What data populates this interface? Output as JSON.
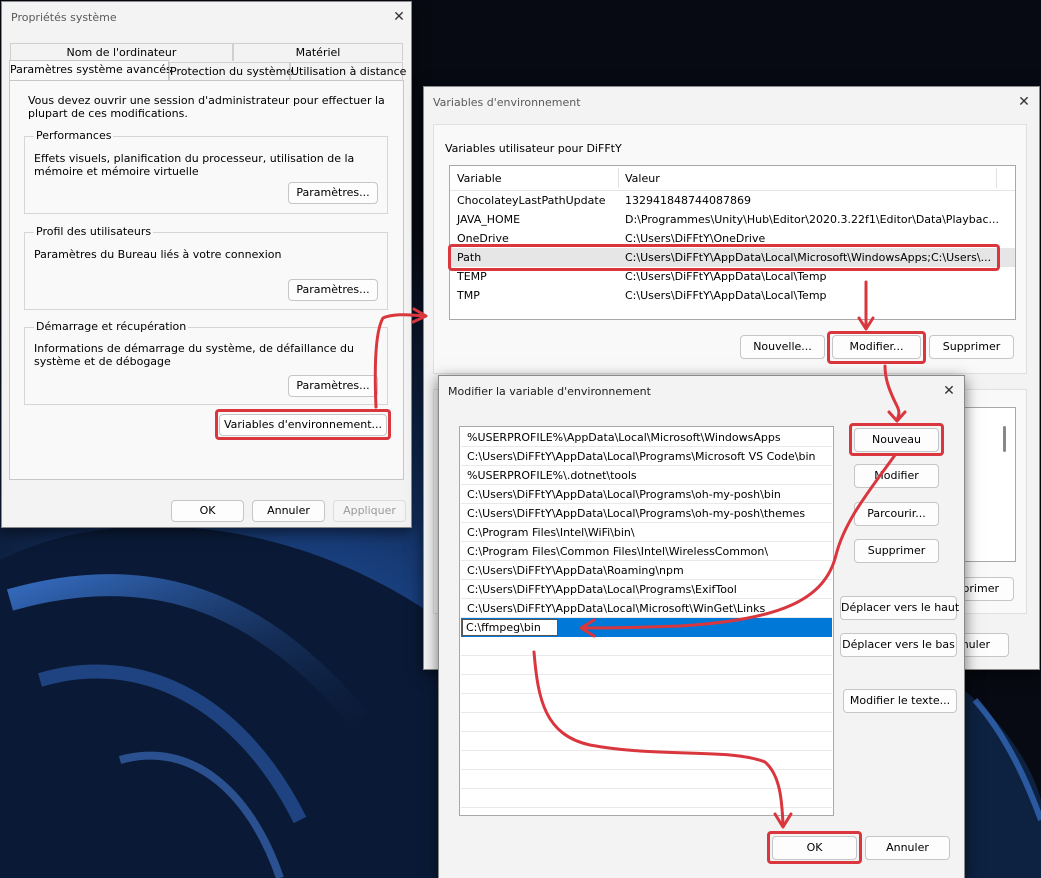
{
  "sys_props": {
    "title": "Propriétés système",
    "tabs_row1": [
      "Nom de l'ordinateur",
      "Matériel"
    ],
    "tabs_row2": [
      "Paramètres système avancés",
      "Protection du système",
      "Utilisation à distance"
    ],
    "intro": "Vous devez ouvrir une session d'administrateur pour effectuer la plupart de ces modifications.",
    "performance": {
      "title": "Performances",
      "desc": "Effets visuels, planification du processeur, utilisation de la mémoire et mémoire virtuelle",
      "button": "Paramètres..."
    },
    "profile": {
      "title": "Profil des utilisateurs",
      "desc": "Paramètres du Bureau liés à votre connexion",
      "button": "Paramètres..."
    },
    "startup": {
      "title": "Démarrage et récupération",
      "desc": "Informations de démarrage du système, de défaillance du système et de débogage",
      "button": "Paramètres..."
    },
    "env_button": "Variables d'environnement...",
    "ok": "OK",
    "cancel": "Annuler",
    "apply": "Appliquer"
  },
  "env_vars": {
    "title": "Variables d'environnement",
    "user_section": "Variables utilisateur pour DiFFtY",
    "columns": [
      "Variable",
      "Valeur"
    ],
    "rows": [
      {
        "name": "ChocolateyLastPathUpdate",
        "value": "132941848744087869"
      },
      {
        "name": "JAVA_HOME",
        "value": "D:\\Programmes\\Unity\\Hub\\Editor\\2020.3.22f1\\Editor\\Data\\Playbac..."
      },
      {
        "name": "OneDrive",
        "value": "C:\\Users\\DiFFtY\\OneDrive"
      },
      {
        "name": "Path",
        "value": "C:\\Users\\DiFFtY\\AppData\\Local\\Microsoft\\WindowsApps;C:\\Users\\..."
      },
      {
        "name": "TEMP",
        "value": "C:\\Users\\DiFFtY\\AppData\\Local\\Temp"
      },
      {
        "name": "TMP",
        "value": "C:\\Users\\DiFFtY\\AppData\\Local\\Temp"
      }
    ],
    "selected_row": "Path",
    "buttons": {
      "new": "Nouvelle...",
      "edit": "Modifier...",
      "delete": "Supprimer"
    },
    "partial_delete": "primer",
    "partial_cancel": "nuler"
  },
  "edit_var": {
    "title": "Modifier la variable d'environnement",
    "entries": [
      "%USERPROFILE%\\AppData\\Local\\Microsoft\\WindowsApps",
      "C:\\Users\\DiFFtY\\AppData\\Local\\Programs\\Microsoft VS Code\\bin",
      "%USERPROFILE%\\.dotnet\\tools",
      "C:\\Users\\DiFFtY\\AppData\\Local\\Programs\\oh-my-posh\\bin",
      "C:\\Users\\DiFFtY\\AppData\\Local\\Programs\\oh-my-posh\\themes",
      "C:\\Program Files\\Intel\\WiFi\\bin\\",
      "C:\\Program Files\\Common Files\\Intel\\WirelessCommon\\",
      "C:\\Users\\DiFFtY\\AppData\\Roaming\\npm",
      "C:\\Users\\DiFFtY\\AppData\\Local\\Programs\\ExifTool",
      "C:\\Users\\DiFFtY\\AppData\\Local\\Microsoft\\WinGet\\Links"
    ],
    "new_entry_value": "C:\\ffmpeg\\bin",
    "buttons": {
      "new": "Nouveau",
      "edit": "Modifier",
      "browse": "Parcourir...",
      "delete": "Supprimer",
      "move_up": "Déplacer vers le haut",
      "move_down": "Déplacer vers le bas",
      "edit_text": "Modifier le texte...",
      "ok": "OK",
      "cancel": "Annuler"
    }
  },
  "colors": {
    "annotation": "#d9363e",
    "selection": "#0078d7",
    "dialog_bg": "#f3f3f3"
  }
}
